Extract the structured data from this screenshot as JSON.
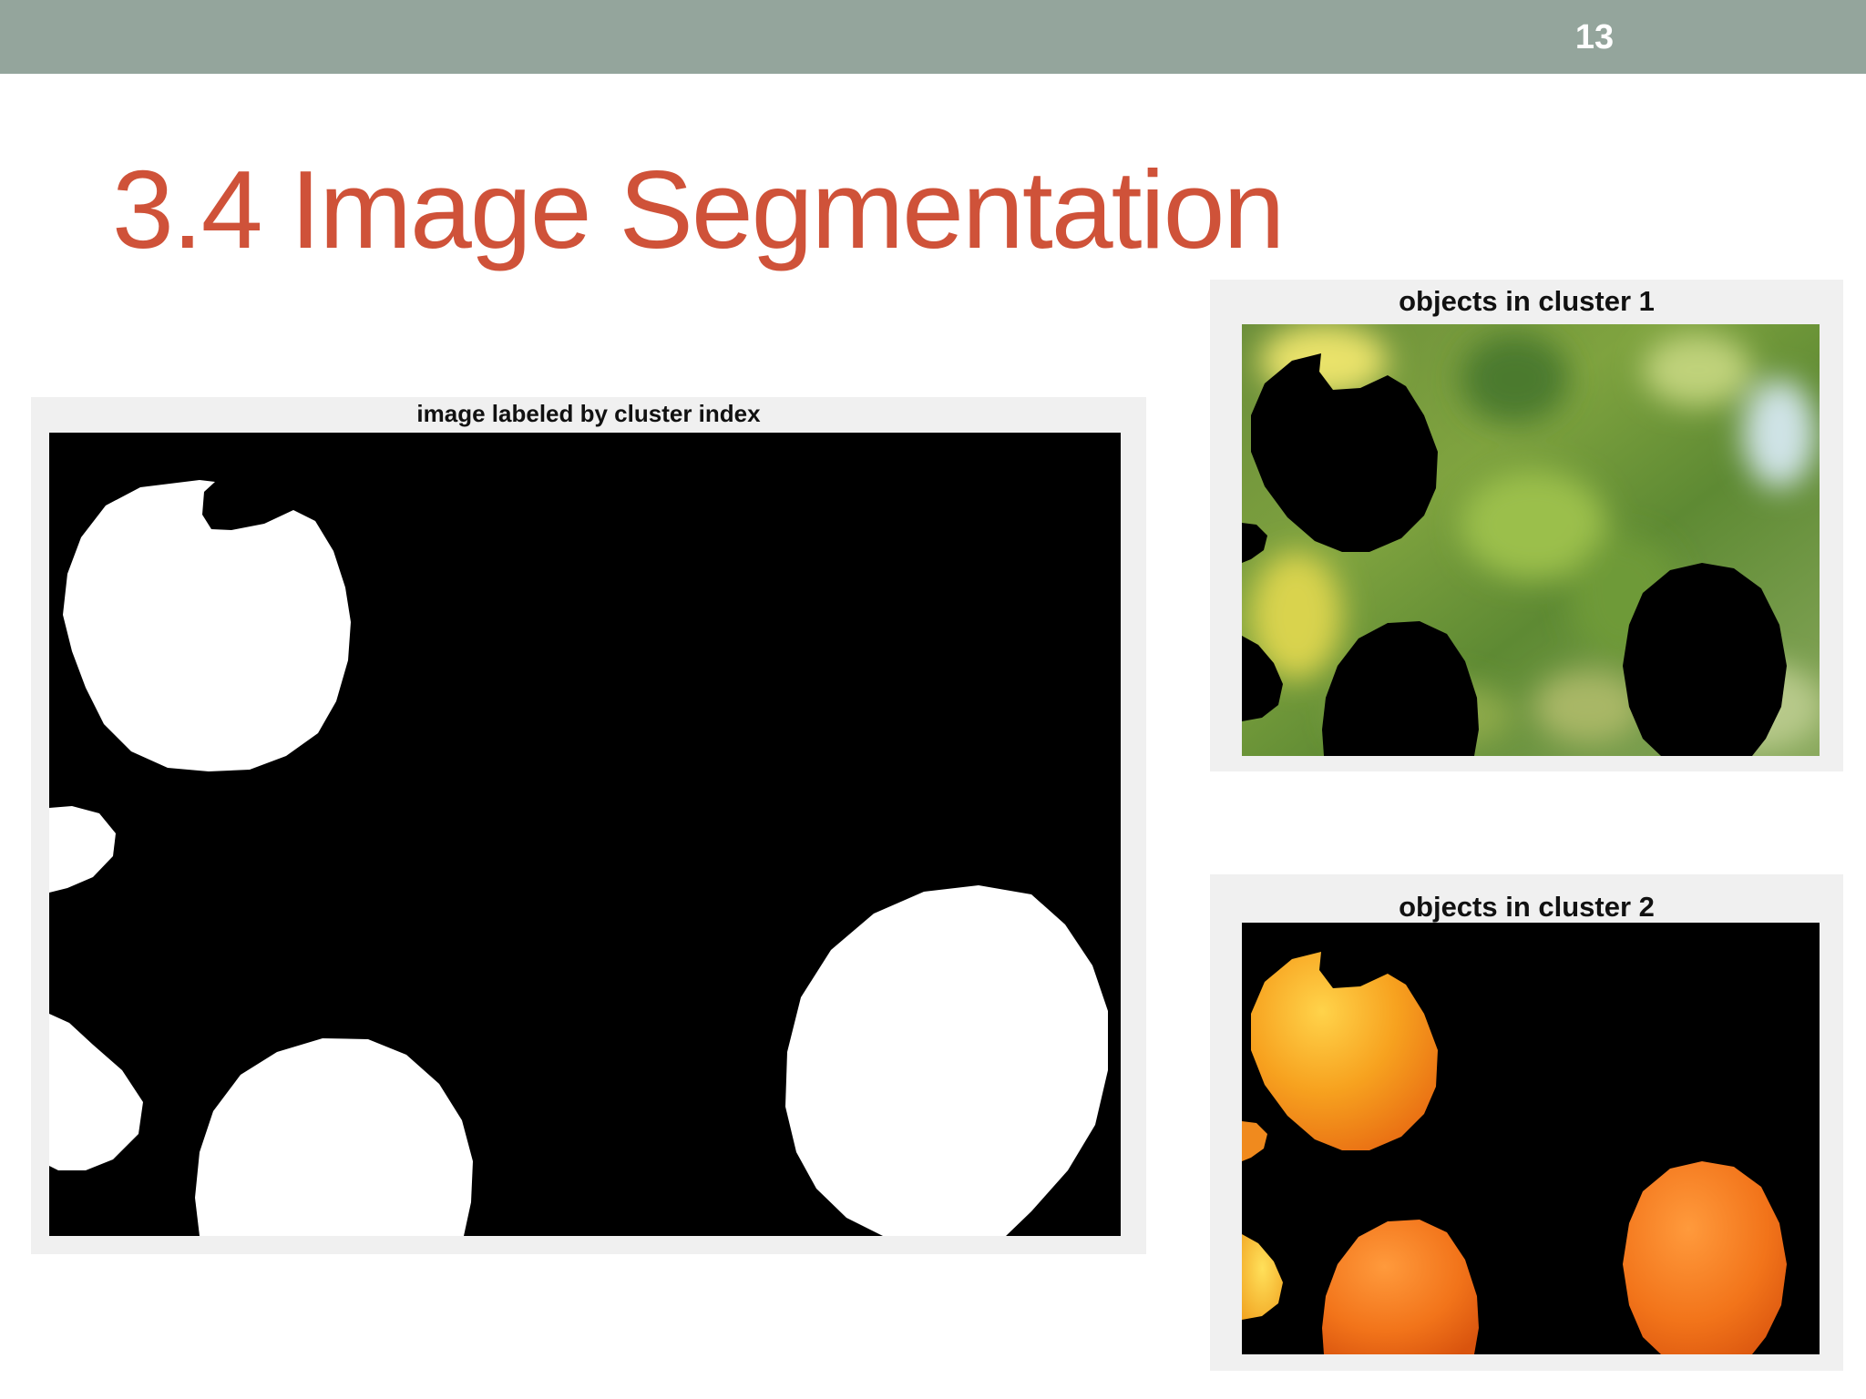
{
  "header": {
    "slide_number": "13",
    "bar_color": "#94a59c"
  },
  "title": "3.4 Image Segmentation",
  "title_color": "#cf5239",
  "figures": {
    "labeled": {
      "title": "image labeled by cluster index"
    },
    "cluster1": {
      "title": "objects in cluster 1"
    },
    "cluster2": {
      "title": "objects in cluster 2"
    }
  }
}
